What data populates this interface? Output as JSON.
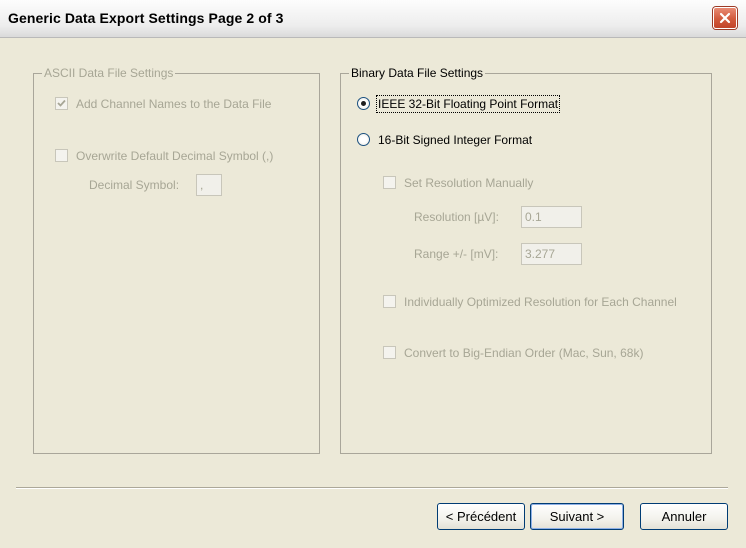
{
  "window": {
    "title": "Generic Data Export Settings Page 2 of 3"
  },
  "ascii": {
    "title": "ASCII Data File Settings",
    "add_channel_names": {
      "label": "Add Channel Names to the Data File",
      "checked": true
    },
    "overwrite_decimal": {
      "label": "Overwrite Default Decimal Symbol (,)",
      "checked": false
    },
    "decimal_symbol": {
      "label": "Decimal Symbol:",
      "value": ","
    }
  },
  "binary": {
    "title": "Binary Data File Settings",
    "ieee_format": {
      "label": "IEEE 32-Bit Floating Point Format",
      "selected": true
    },
    "int16_format": {
      "label": "16-Bit Signed Integer Format",
      "selected": false
    },
    "set_resolution": {
      "label": "Set Resolution Manually",
      "checked": false
    },
    "resolution": {
      "label": "Resolution [µV]:",
      "value": "0.1"
    },
    "range": {
      "label": "Range +/- [mV]:",
      "value": "3.277"
    },
    "individual_resolution": {
      "label": "Individually Optimized Resolution for Each Channel",
      "checked": false
    },
    "big_endian": {
      "label": "Convert to Big-Endian Order (Mac, Sun, 68k)",
      "checked": false
    }
  },
  "buttons": {
    "previous": "< Précédent",
    "next": "Suivant >",
    "cancel": "Annuler"
  }
}
